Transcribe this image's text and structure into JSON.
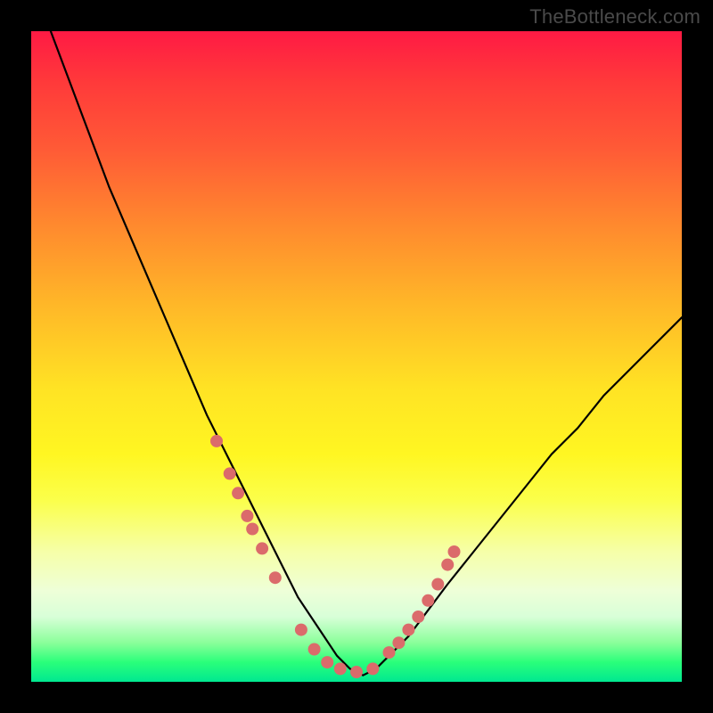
{
  "watermark": "TheBottleneck.com",
  "chart_data": {
    "type": "line",
    "title": "",
    "xlabel": "",
    "ylabel": "",
    "xlim": [
      0,
      100
    ],
    "ylim": [
      0,
      100
    ],
    "series": [
      {
        "name": "bottleneck-curve",
        "x": [
          3,
          6,
          9,
          12,
          15,
          18,
          21,
          24,
          27,
          30,
          33,
          36,
          39,
          41,
          43,
          45,
          47,
          49,
          51,
          53,
          55,
          58,
          61,
          64,
          68,
          72,
          76,
          80,
          84,
          88,
          92,
          96,
          100
        ],
        "y": [
          100,
          92,
          84,
          76,
          69,
          62,
          55,
          48,
          41,
          35,
          29,
          23,
          17,
          13,
          10,
          7,
          4,
          2,
          1,
          2,
          4,
          7,
          11,
          15,
          20,
          25,
          30,
          35,
          39,
          44,
          48,
          52,
          56
        ]
      }
    ],
    "markers": {
      "name": "highlight-points",
      "color": "#db6b6b",
      "radius_px": 7,
      "x": [
        28.5,
        30.5,
        31.8,
        33.2,
        34.0,
        35.5,
        37.5,
        41.5,
        43.5,
        45.5,
        47.5,
        50.0,
        52.5,
        55.0,
        56.5,
        58.0,
        59.5,
        61.0,
        62.5,
        64.0,
        65.0
      ],
      "y": [
        37.0,
        32.0,
        29.0,
        25.5,
        23.5,
        20.5,
        16.0,
        8.0,
        5.0,
        3.0,
        2.0,
        1.5,
        2.0,
        4.5,
        6.0,
        8.0,
        10.0,
        12.5,
        15.0,
        18.0,
        20.0
      ]
    }
  }
}
